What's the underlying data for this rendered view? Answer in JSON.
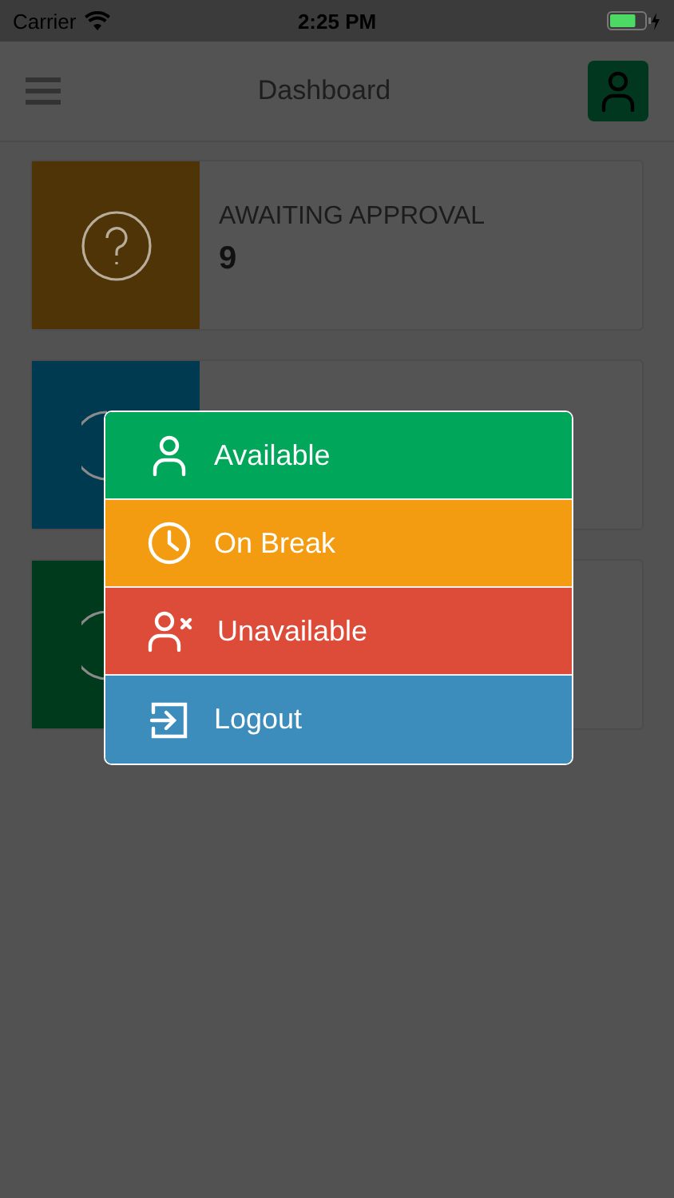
{
  "status_bar": {
    "carrier": "Carrier",
    "time": "2:25 PM",
    "battery": {
      "level": 0.75
    }
  },
  "header": {
    "title": "Dashboard"
  },
  "cards": [
    {
      "kind": "question",
      "label": "AWAITING APPROVAL",
      "count": "9",
      "color": "#4f3407"
    },
    {
      "kind": "arc",
      "color": "#003a50"
    },
    {
      "kind": "arc",
      "color": "#003a1d"
    }
  ],
  "status_menu": [
    {
      "kind": "person",
      "label": "Available",
      "color": "#00a65a"
    },
    {
      "kind": "clock",
      "label": "On Break",
      "color": "#f39c12"
    },
    {
      "kind": "person-x",
      "label": "Unavailable",
      "color": "#dd4b39"
    },
    {
      "kind": "logout",
      "label": "Logout",
      "color": "#3c8dbc"
    }
  ]
}
